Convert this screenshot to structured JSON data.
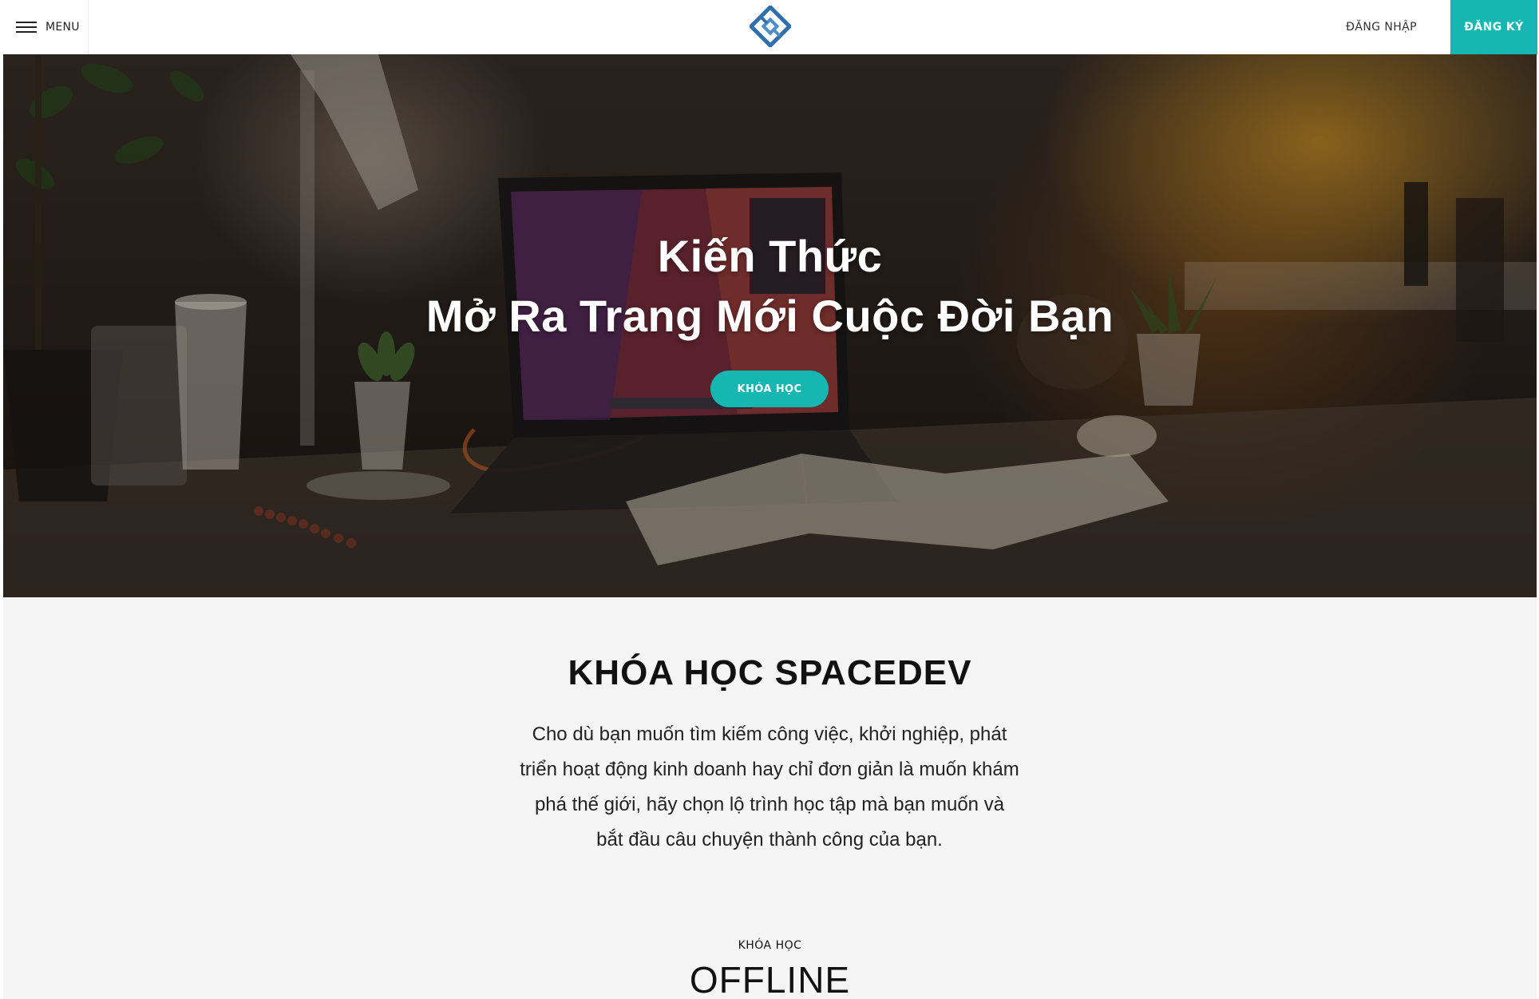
{
  "header": {
    "menu_label": "MENU",
    "login_label": "ĐĂNG NHẬP",
    "signup_label": "ĐĂNG KÝ",
    "logo_icon": "diamond-logo-icon",
    "accent_color": "#16b6b2"
  },
  "hero": {
    "title_line1": "Kiến Thức",
    "title_line2": "Mở Ra Trang Mới Cuộc Đời Bạn",
    "cta_label": "KHÓA HỌC"
  },
  "courses": {
    "title": "KHÓA HỌC SPACEDEV",
    "description_lines": [
      "Cho dù bạn muốn tìm kiếm công việc, khởi nghiệp, phát",
      "triển hoạt động kinh doanh hay chỉ đơn giản là muốn khám",
      "phá thế giới, hãy chọn lộ trình học tập mà bạn muốn và",
      "bắt đầu câu chuyện thành công của bạn."
    ],
    "eyebrow": "KHÓA HỌC",
    "subtitle": "OFFLINE"
  }
}
